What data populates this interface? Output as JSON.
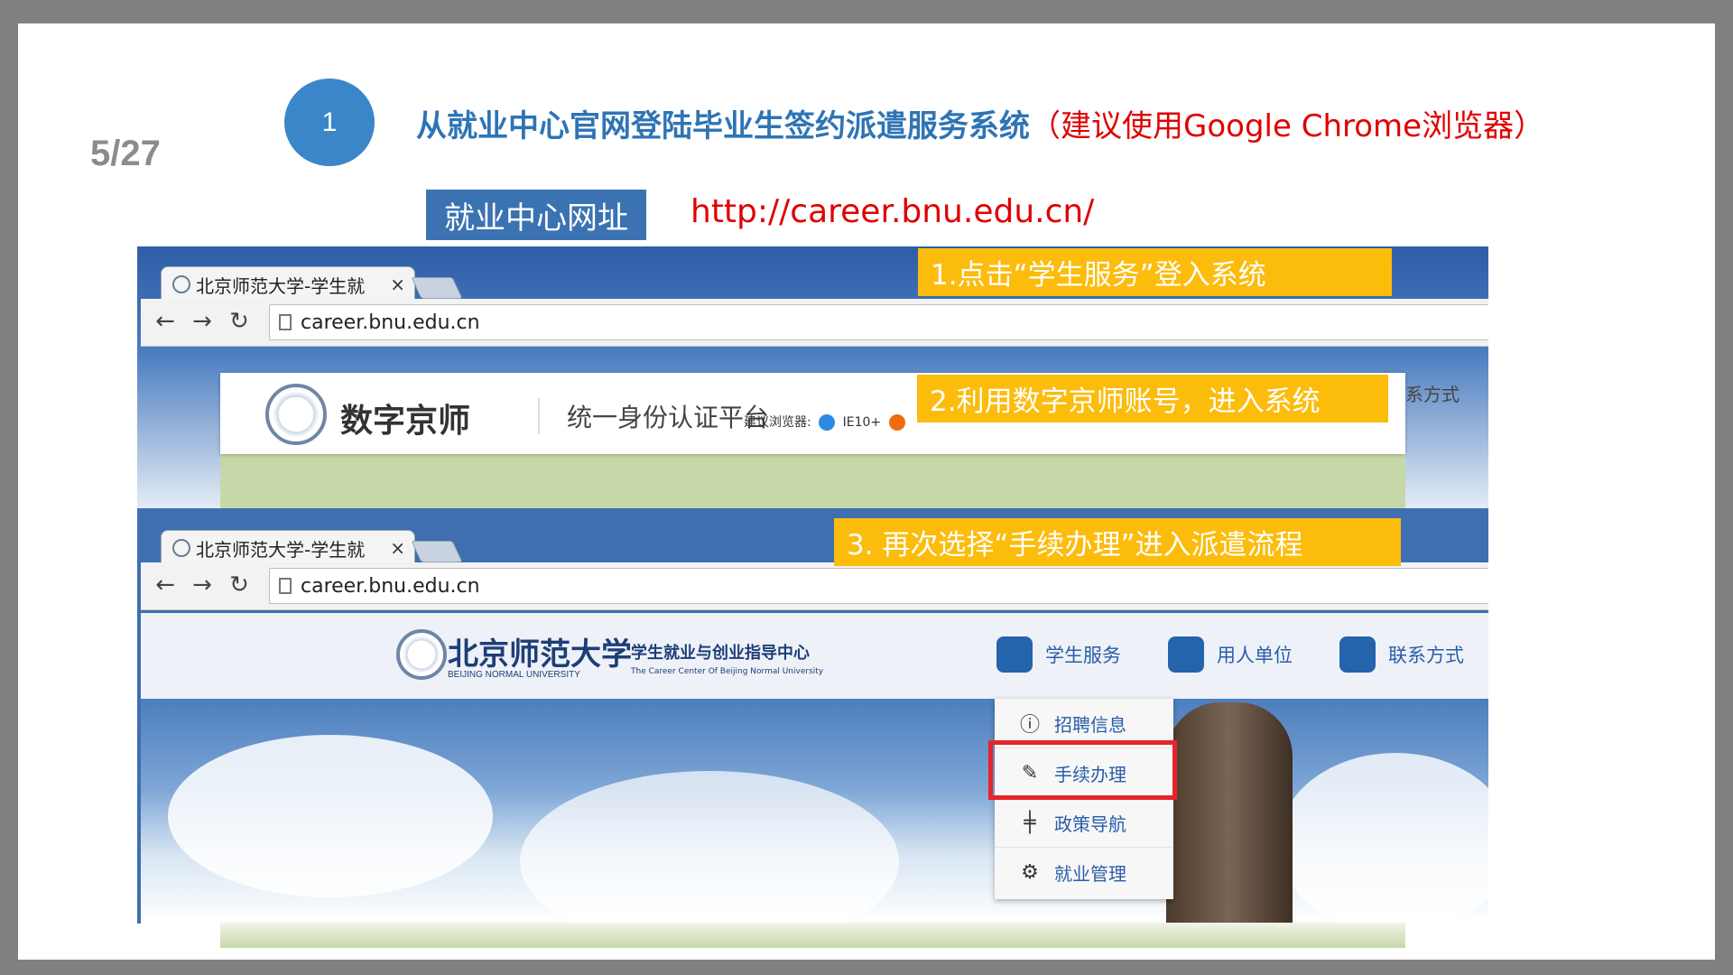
{
  "slide": {
    "page_number": "5/27",
    "step_number": "1",
    "title_main": "从就业中心官网登陆毕业生签约派遣服务系统",
    "title_note": "（建议使用Google Chrome浏览器）",
    "url_label": "就业中心网址",
    "url_value": "http://career.bnu.edu.cn/"
  },
  "browser1": {
    "tab_title": "北京师范大学-学生就",
    "tab_close": "×",
    "address": "career.bnu.edu.cn"
  },
  "browser2": {
    "tab_title": "北京师范大学-学生就",
    "tab_close": "×",
    "address": "career.bnu.edu.cn"
  },
  "callouts": {
    "step1": "1.点击“学生服务”登入系统",
    "step2": "2.利用数字京师账号，进入系统",
    "step3": "3. 再次选择“手续办理”进入派遣流程"
  },
  "login": {
    "brand": "数字京师",
    "platform": "统一身份认证平台",
    "browsers_label": "建议浏览器:",
    "ie_label": "IE10+",
    "contact_peek": "系方式"
  },
  "site": {
    "logo_text": "北京师范大学",
    "logo_sub": "BEIJING NORMAL UNIVERSITY",
    "center_name": "学生就业与创业指导中心",
    "center_en": "The Career Center Of Beijing Normal University",
    "nav": [
      "学生服务",
      "用人单位",
      "联系方式"
    ],
    "dropdown": [
      {
        "label": "招聘信息",
        "icon": "info-icon"
      },
      {
        "label": "手续办理",
        "icon": "edit-icon"
      },
      {
        "label": "政策导航",
        "icon": "signpost-icon"
      },
      {
        "label": "就业管理",
        "icon": "gear-icon"
      }
    ]
  },
  "colors": {
    "accent_blue": "#3a86c8",
    "title_blue": "#2e74b5",
    "note_red": "#e00000",
    "callout_yellow": "#fcbc0c",
    "highlight_red": "#e8232b"
  }
}
